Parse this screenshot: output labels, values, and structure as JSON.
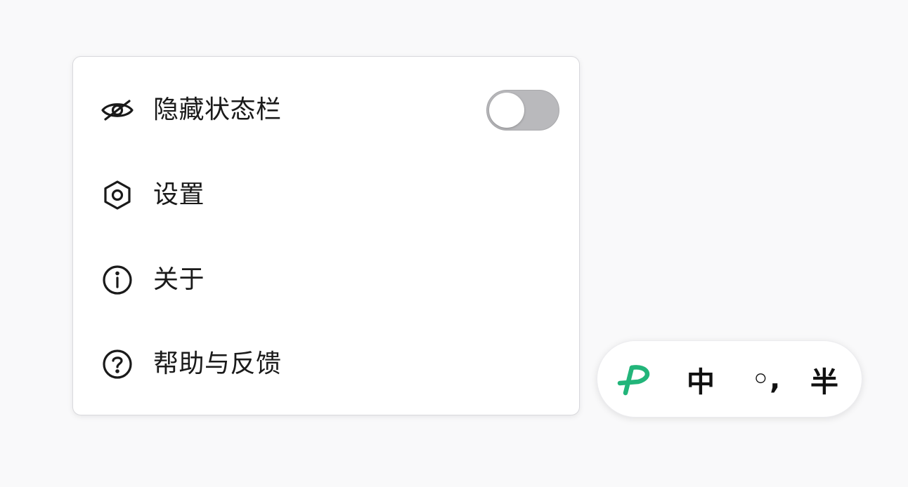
{
  "menu": {
    "items": [
      {
        "icon": "eye-slash-icon",
        "label": "隐藏状态栏",
        "toggle": {
          "state": "off"
        }
      },
      {
        "icon": "settings-hexagon-icon",
        "label": "设置"
      },
      {
        "icon": "info-circle-icon",
        "label": "关于"
      },
      {
        "icon": "help-circle-icon",
        "label": "帮助与反馈"
      }
    ]
  },
  "ime_bar": {
    "logo_icon": "ime-logo-icon",
    "logo_color": "#22b57a",
    "language": "中",
    "punctuation": "◦,",
    "width_mode": "半"
  }
}
